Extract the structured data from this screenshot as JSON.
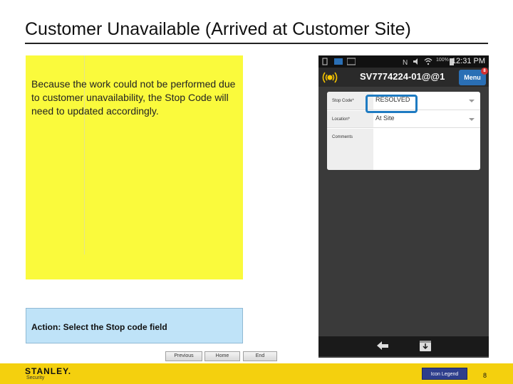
{
  "slide": {
    "title": "Customer Unavailable (Arrived at Customer Site)",
    "note_text": "Because the work could not be performed due to customer unavailability, the Stop Code will need to updated accordingly.",
    "action_text": "Action: Select the Stop code field"
  },
  "nav": {
    "previous": "Previous",
    "home": "Home",
    "end": "End"
  },
  "phone": {
    "status_time": "12:31 PM",
    "battery": "100%",
    "app_title": "SV7774224-01@@1",
    "menu_label": "Menu",
    "menu_badge": "8",
    "form": {
      "stop_code_label": "Stop Code*",
      "stop_code_value": "RESOLVED",
      "location_label": "Location*",
      "location_value": "At Site",
      "comments_label": "Comments"
    }
  },
  "footer": {
    "logo": "STANLEY.",
    "logo_sub": "Security",
    "icon_legend": "Icon Legend",
    "page_number": "8"
  },
  "colors": {
    "note_bg": "#fafa3c",
    "action_bg": "#bfe3f8",
    "footer_bg": "#f4d00e",
    "highlight": "#1e7bc2",
    "menu_button": "#2a6fb5",
    "legend_button": "#2e3e8c"
  }
}
